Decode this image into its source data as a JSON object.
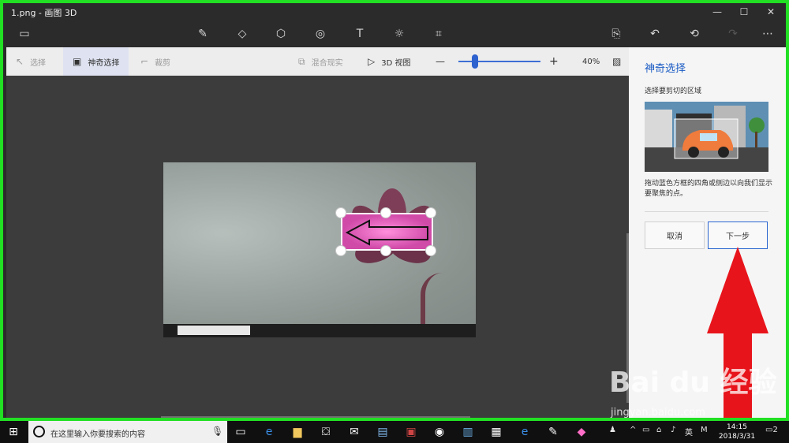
{
  "window": {
    "title": "1.png - 画图 3D",
    "controls": [
      "—",
      "☐",
      "✕"
    ]
  },
  "toolbar": {
    "icons": [
      {
        "name": "menu-icon",
        "glyph": "▭"
      },
      {
        "name": "brush-icon",
        "glyph": "✎"
      },
      {
        "name": "2d-shapes-icon",
        "glyph": "◇"
      },
      {
        "name": "3d-shapes-icon",
        "glyph": "⬡"
      },
      {
        "name": "stickers-icon",
        "glyph": "◎"
      },
      {
        "name": "text-icon",
        "glyph": "T"
      },
      {
        "name": "effects-icon",
        "glyph": "☼"
      },
      {
        "name": "canvas-icon",
        "glyph": "⌗"
      },
      {
        "name": "paste-icon",
        "glyph": "⎘"
      },
      {
        "name": "undo-icon",
        "glyph": "↶"
      },
      {
        "name": "history-icon",
        "glyph": "⟲"
      },
      {
        "name": "redo-icon",
        "glyph": "↷"
      },
      {
        "name": "more-icon",
        "glyph": "⋯"
      }
    ]
  },
  "subbar": {
    "select_label": "选择",
    "magic_select_label": "神奇选择",
    "crop_label": "裁剪",
    "mixed_reality_label": "混合现实",
    "view3d_label": "3D 视图",
    "zoom_minus": "—",
    "zoom_plus": "+",
    "zoom_level": "40%",
    "zoom_value": 0.2
  },
  "panel": {
    "heading": "神奇选择",
    "subheading": "选择要剪切的区域",
    "description": "拖动蓝色方框的四角或侧边以向我们显示要聚焦的点。",
    "cancel_label": "取消",
    "next_label": "下一步"
  },
  "watermark": {
    "main": "Bai du 经验",
    "sub": "jingyan.baidu.com"
  },
  "taskbar": {
    "search_placeholder": "在这里输入你要搜索的内容",
    "ime": "英",
    "ime2": "M",
    "time": "14:15",
    "date": "2018/3/31",
    "notification_count": "2"
  },
  "colors": {
    "frame_border": "#22e024",
    "accent": "#1a5bc4",
    "arrow": "#e8141b",
    "selection_fill": "#e86bc6"
  }
}
